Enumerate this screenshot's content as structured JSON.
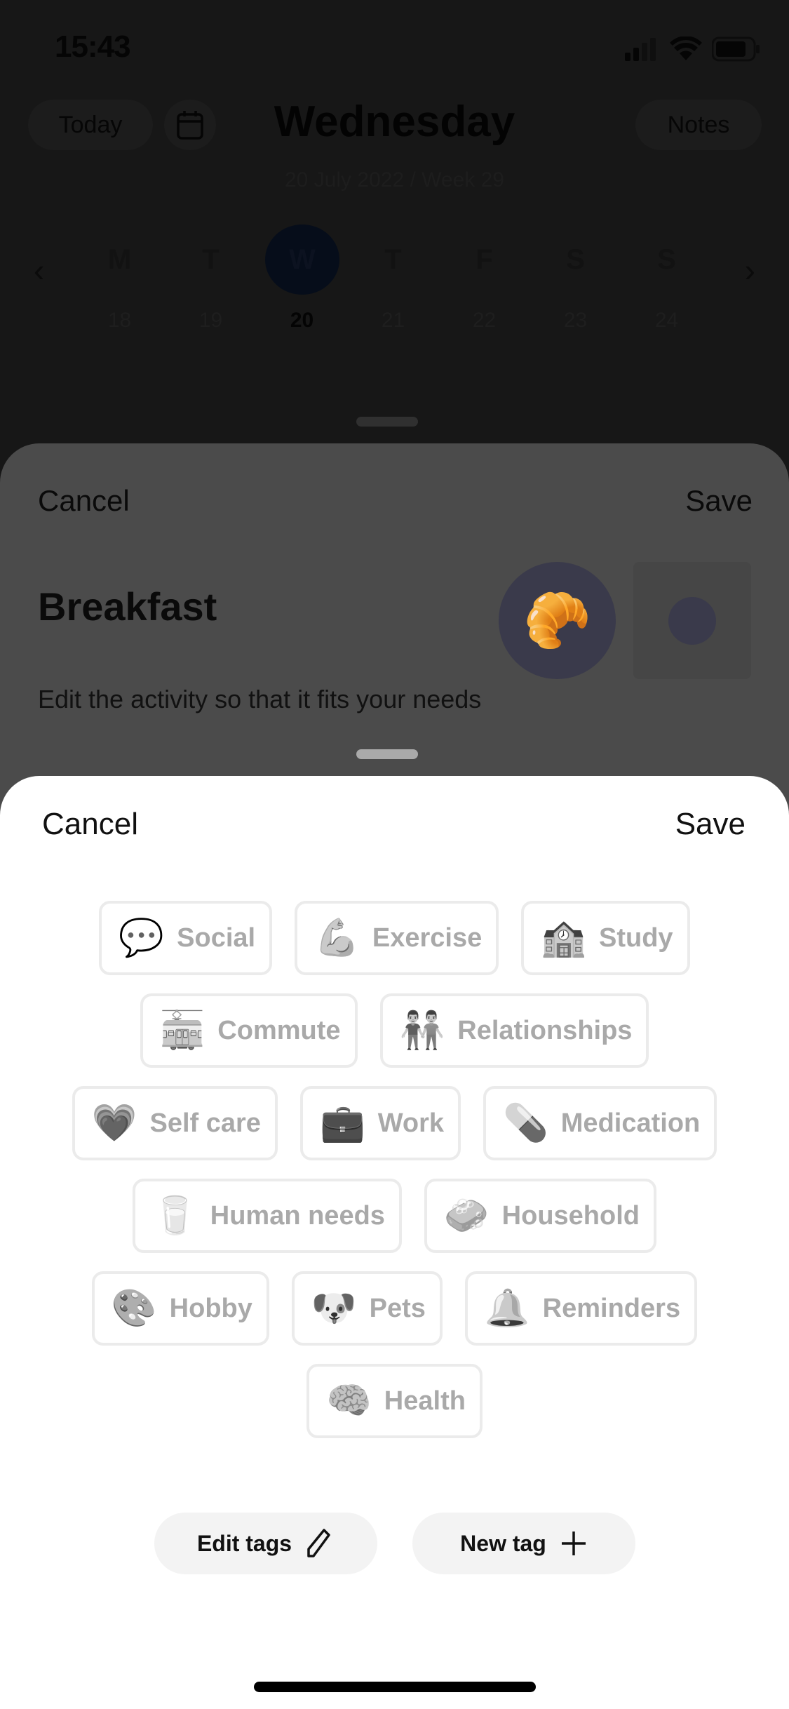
{
  "status_bar": {
    "time": "15:43"
  },
  "background_screen": {
    "today_label": "Today",
    "notes_label": "Notes",
    "title": "Wednesday",
    "subtitle": "20 July 2022 / Week 29",
    "week_days": [
      {
        "letter": "M",
        "date": "18"
      },
      {
        "letter": "T",
        "date": "19"
      },
      {
        "letter": "W",
        "date": "20",
        "selected": true
      },
      {
        "letter": "T",
        "date": "21"
      },
      {
        "letter": "F",
        "date": "22"
      },
      {
        "letter": "S",
        "date": "23"
      },
      {
        "letter": "S",
        "date": "24"
      }
    ]
  },
  "activity_sheet": {
    "cancel_label": "Cancel",
    "save_label": "Save",
    "title": "Breakfast",
    "description": "Edit the activity so that it fits your needs",
    "emoji": "🥐",
    "accent_color": "#3a3a4b"
  },
  "tags_sheet": {
    "cancel_label": "Cancel",
    "save_label": "Save",
    "rows": [
      [
        {
          "icon": "💬",
          "label": "Social"
        },
        {
          "icon": "💪",
          "label": "Exercise"
        },
        {
          "icon": "🏫",
          "label": "Study"
        }
      ],
      [
        {
          "icon": "🚋",
          "label": "Commute"
        },
        {
          "icon": "👬",
          "label": "Relationships"
        }
      ],
      [
        {
          "icon": "💗",
          "label": "Self care"
        },
        {
          "icon": "💼",
          "label": "Work"
        },
        {
          "icon": "💊",
          "label": "Medication"
        }
      ],
      [
        {
          "icon": "🥛",
          "label": "Human needs"
        },
        {
          "icon": "🧼",
          "label": "Household"
        }
      ],
      [
        {
          "icon": "🎨",
          "label": "Hobby"
        },
        {
          "icon": "🐶",
          "label": "Pets"
        },
        {
          "icon": "🔔",
          "label": "Reminders"
        }
      ],
      [
        {
          "icon": "🧠",
          "label": "Health"
        }
      ]
    ],
    "edit_tags_label": "Edit tags",
    "new_tag_label": "New tag"
  }
}
